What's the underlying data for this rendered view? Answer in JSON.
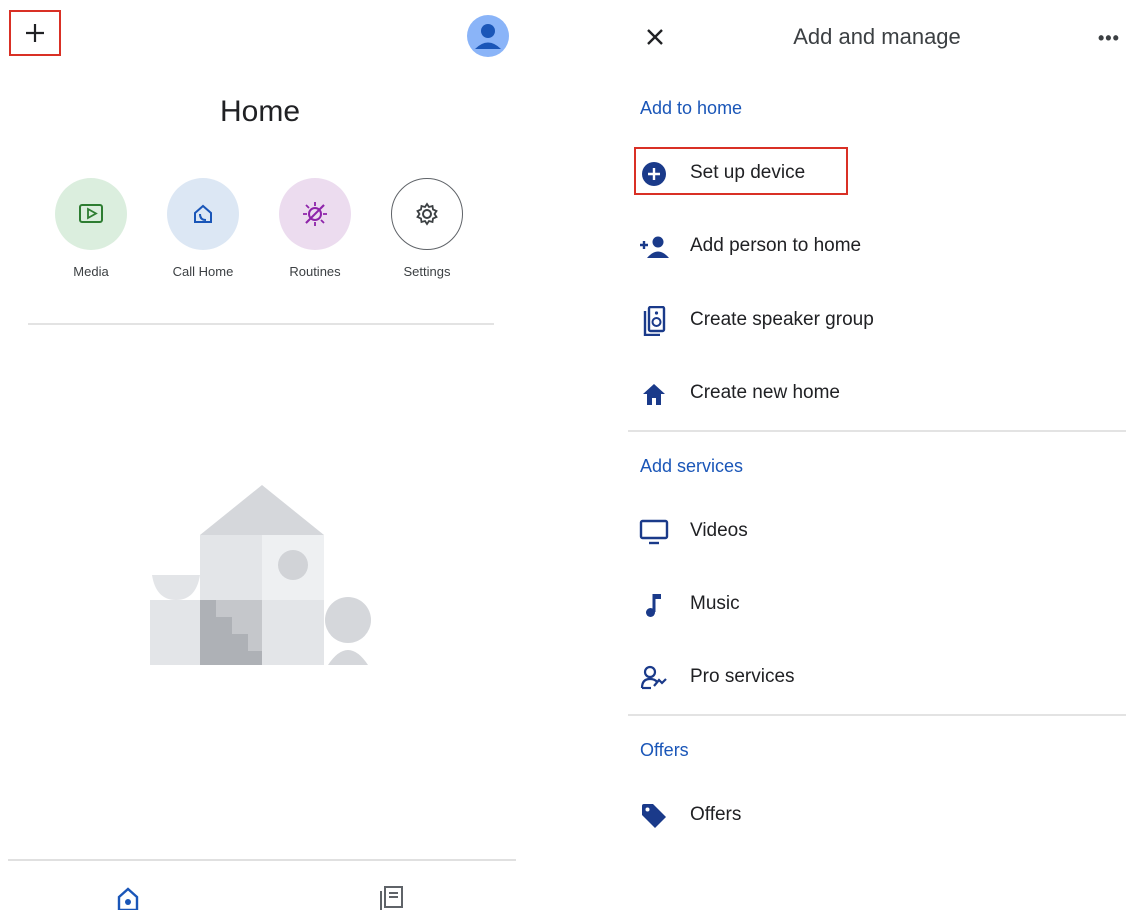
{
  "left": {
    "title": "Home",
    "shortcuts": [
      {
        "label": "Media",
        "icon": "media-icon",
        "color": "#dbeede"
      },
      {
        "label": "Call Home",
        "icon": "call-home-icon",
        "color": "#dce7f4"
      },
      {
        "label": "Routines",
        "icon": "routines-icon",
        "color": "#ecdcef"
      },
      {
        "label": "Settings",
        "icon": "gear-icon",
        "color": "#ffffff"
      }
    ]
  },
  "right": {
    "title": "Add and manage",
    "sections": [
      {
        "label": "Add to home",
        "items": [
          "Set up device",
          "Add person to home",
          "Create speaker group",
          "Create new home"
        ]
      },
      {
        "label": "Add services",
        "items": [
          "Videos",
          "Music",
          "Pro services"
        ]
      },
      {
        "label": "Offers",
        "items": [
          "Offers"
        ]
      }
    ]
  },
  "colors": {
    "accent": "#1a56b8",
    "highlight": "#d93025"
  }
}
